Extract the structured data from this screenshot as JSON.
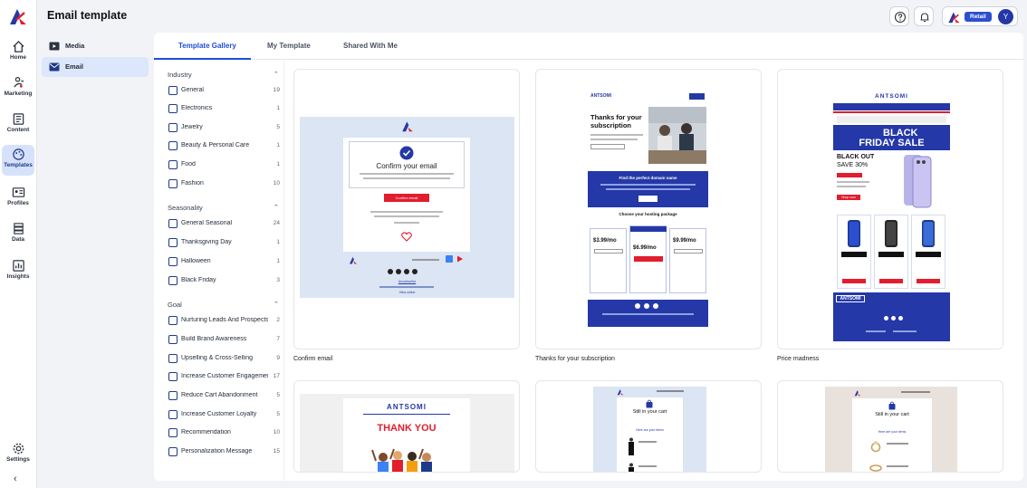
{
  "app": {
    "title": "Email template",
    "account_badge": "Retail",
    "avatar_initial": "Y"
  },
  "nav": [
    {
      "label": "Home",
      "icon": "home-icon"
    },
    {
      "label": "Marketing",
      "icon": "marketing-icon"
    },
    {
      "label": "Content",
      "icon": "content-icon"
    },
    {
      "label": "Templates",
      "icon": "templates-icon"
    },
    {
      "label": "Profiles",
      "icon": "profiles-icon"
    },
    {
      "label": "Data",
      "icon": "data-icon"
    },
    {
      "label": "Insights",
      "icon": "insights-icon"
    },
    {
      "label": "Settings",
      "icon": "settings-icon"
    }
  ],
  "collapse_glyph": "‹",
  "subnav": [
    {
      "label": "Media"
    },
    {
      "label": "Email"
    }
  ],
  "tabs": [
    {
      "label": "Template Gallery"
    },
    {
      "label": "My Template"
    },
    {
      "label": "Shared With Me"
    }
  ],
  "filters": {
    "industry": {
      "title": "Industry",
      "items": [
        {
          "name": "General",
          "count": "19"
        },
        {
          "name": "Electronics",
          "count": "1"
        },
        {
          "name": "Jewelry",
          "count": "5"
        },
        {
          "name": "Beauty & Personal Care",
          "count": "1"
        },
        {
          "name": "Food",
          "count": "1"
        },
        {
          "name": "Fashion",
          "count": "10"
        }
      ]
    },
    "seasonality": {
      "title": "Seasonality",
      "items": [
        {
          "name": "General Seasonal",
          "count": "24"
        },
        {
          "name": "Thanksgiving Day",
          "count": "1"
        },
        {
          "name": "Halloween",
          "count": "1"
        },
        {
          "name": "Black Friday",
          "count": "3"
        }
      ]
    },
    "goal": {
      "title": "Goal",
      "items": [
        {
          "name": "Nurturing Leads And Prospects",
          "count": "2"
        },
        {
          "name": "Build Brand Awareness",
          "count": "7"
        },
        {
          "name": "Upselling & Cross-Selling",
          "count": "9"
        },
        {
          "name": "Increase Customer Engagement",
          "count": "17"
        },
        {
          "name": "Reduce Cart Abandonment",
          "count": "5"
        },
        {
          "name": "Increase Customer Loyalty",
          "count": "5"
        },
        {
          "name": "Recommendation",
          "count": "10"
        },
        {
          "name": "Personalization Message",
          "count": "15"
        }
      ]
    }
  },
  "templates": [
    {
      "name": "Confirm email",
      "preview": {
        "heading": "Confirm your email",
        "button": "Confirm email",
        "link1": "Unsubscribe",
        "link2": "View online"
      }
    },
    {
      "name": "Thanks for your subscription",
      "preview": {
        "brand": "ANTSOMI",
        "heading": "Thanks for your subscription",
        "section1": "Find the perfect domain name",
        "section2": "Choose your hosting package",
        "price1": "$3.99/mo",
        "price2": "$6.99/mo",
        "price3": "$9.99/mo"
      }
    },
    {
      "name": "Price madness",
      "preview": {
        "brand": "ANTSOMI",
        "line1": "BLACK",
        "line2": "FRIDAY SALE",
        "line3": "BLACK OUT",
        "line4": "SAVE 30%",
        "button": "Shop now"
      }
    },
    {
      "preview": {
        "brand": "ANTSOMI",
        "heading": "THANK YOU"
      }
    },
    {
      "preview": {
        "heading": "Still in your cart",
        "sub": "Here are your items"
      }
    },
    {
      "preview": {
        "heading": "Still in your cart",
        "sub": "Here are your items"
      }
    }
  ],
  "colors": {
    "accent": "#1d4ed8",
    "navy": "#2438a8",
    "active_bg": "#d6e2fb",
    "red": "#e11d2e"
  }
}
